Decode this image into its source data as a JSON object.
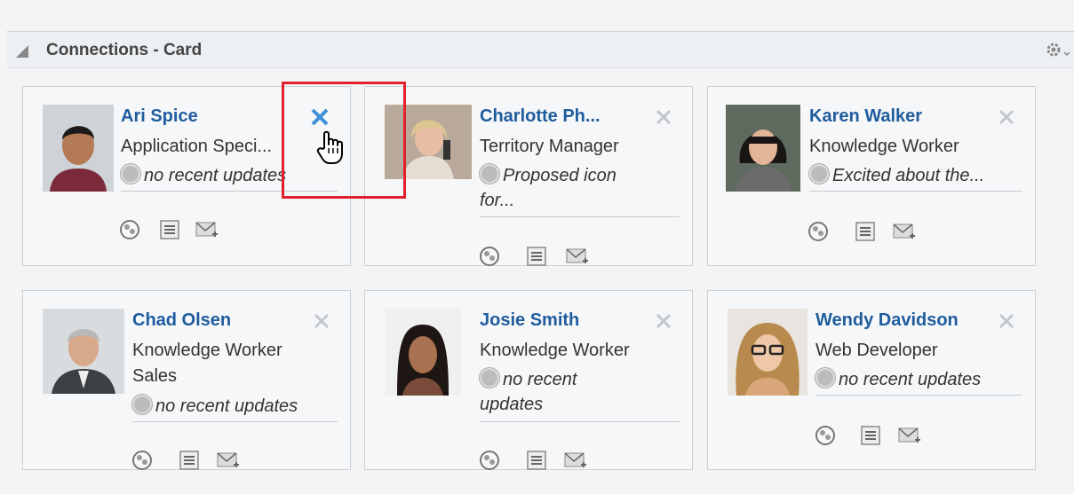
{
  "panel": {
    "title": "Connections - Card"
  },
  "cards": [
    {
      "name": "Ari Spice",
      "title": "Application Speci...",
      "status": "no recent updates"
    },
    {
      "name": "Charlotte Ph...",
      "title": "Territory Manager",
      "status_line1": "Proposed icon",
      "status_line2": "for..."
    },
    {
      "name": "Karen Walker",
      "title": "Knowledge Worker",
      "status": "Excited about the..."
    },
    {
      "name": "Chad Olsen",
      "title": "Knowledge Worker",
      "department": "Sales",
      "status": "no recent updates"
    },
    {
      "name": "Josie Smith",
      "title": "Knowledge Worker",
      "status_line1": "no recent",
      "status_line2": "updates"
    },
    {
      "name": "Wendy Davidson",
      "title": "Web Developer",
      "status": "no recent updates"
    }
  ],
  "icons": {
    "collapse": "collapse-triangle-icon",
    "settings": "gear-menu-icon",
    "remove": "remove-x-icon",
    "connections": "connections-icon",
    "activity": "activity-list-icon",
    "message": "send-message-icon"
  },
  "colors": {
    "name_link": "#1f5c9e",
    "remove_active": "#3d8fd6",
    "highlight": "#e0212b"
  }
}
